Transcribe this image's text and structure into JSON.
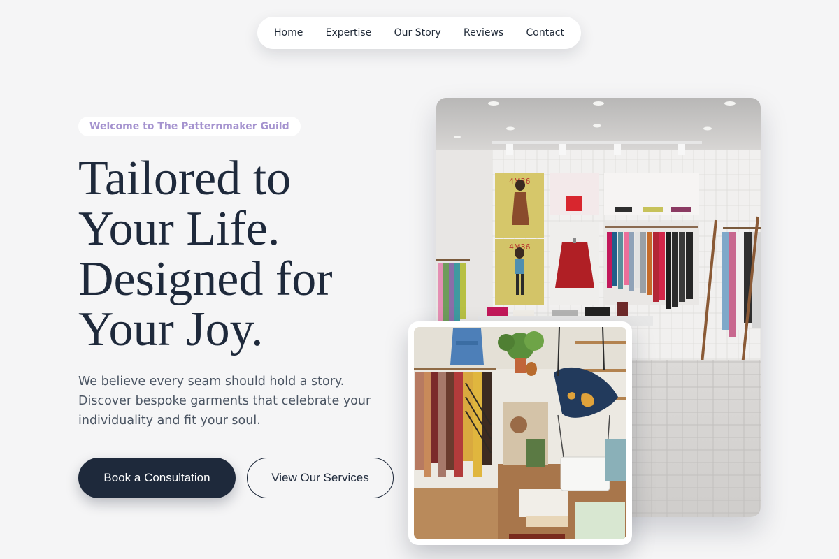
{
  "nav": {
    "items": [
      {
        "label": "Home"
      },
      {
        "label": "Expertise"
      },
      {
        "label": "Our Story"
      },
      {
        "label": "Reviews"
      },
      {
        "label": "Contact"
      }
    ]
  },
  "hero": {
    "badge": "Welcome to The Patternmaker Guild",
    "headline_lines": [
      "Tailored to",
      "Your Life.",
      "Designed for",
      "Your Joy."
    ],
    "lead_lines": [
      "We believe every seam should hold a story.",
      "Discover bespoke garments that celebrate your",
      "individuality and fit your soul."
    ],
    "primary_cta": "Book a Consultation",
    "secondary_cta": "View Our Services"
  },
  "media": {
    "main_photo": "boutique-store-interior-photo",
    "inset_photo": "craft-shop-interior-photo",
    "poster_text": [
      "4M36",
      "4M36"
    ]
  },
  "colors": {
    "background": "#f5f5f6",
    "primary": "#1e293b",
    "badge_text": "#a593cf",
    "body_text": "#4b5563"
  }
}
